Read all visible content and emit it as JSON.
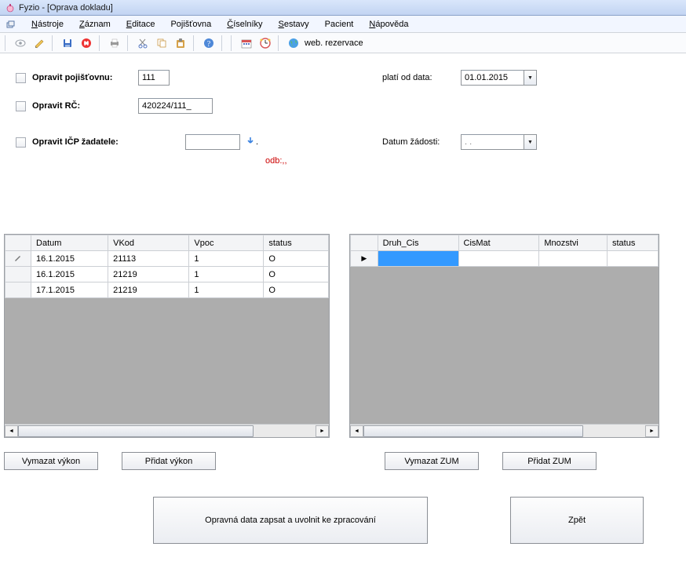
{
  "title": "Fyzio  - [Oprava dokladu]",
  "menubar": {
    "items": [
      "Nástroje",
      "Záznam",
      "Editace",
      "Pojišťovna",
      "Číselníky",
      "Sestavy",
      "Pacient",
      "Nápověda"
    ],
    "accel_pos": [
      0,
      0,
      0,
      null,
      0,
      0,
      null,
      0
    ]
  },
  "toolbar": {
    "web_reservation": "web. rezervace"
  },
  "form": {
    "cb_pojistovna_label": "Opravit pojišťovnu:",
    "pojistovna_value": "111",
    "plati_od_label": "platí od data:",
    "plati_od_value": "01.01.2015",
    "cb_rc_label": "Opravit RČ:",
    "rc_value": "420224/111_",
    "cb_icp_label": "Opravit IČP žadatele:",
    "icp_value": "",
    "icp_dot": ".",
    "odb_label": "odb:,,",
    "datum_zadosti_label": "Datum žádosti:",
    "datum_zadosti_value": ". ."
  },
  "grid_left": {
    "headers": [
      "Datum",
      "VKod",
      "Vpoc",
      "status"
    ],
    "rows": [
      {
        "datum": "16.1.2015",
        "vkod": "21113",
        "vpoc": "1",
        "status": "O",
        "editing": true
      },
      {
        "datum": "16.1.2015",
        "vkod": "21219",
        "vpoc": "1",
        "status": "O",
        "editing": false
      },
      {
        "datum": "17.1.2015",
        "vkod": "21219",
        "vpoc": "1",
        "status": "O",
        "editing": false
      }
    ]
  },
  "grid_right": {
    "headers": [
      "Druh_Cis",
      "CisMat",
      "Mnozstvi",
      "status"
    ]
  },
  "buttons": {
    "vymazat_vykon": "Vymazat výkon",
    "pridat_vykon": "Přidat výkon",
    "vymazat_zum": "Vymazat ZUM",
    "pridat_zum": "Přidat ZUM",
    "zapsat": "Opravná data zapsat a uvolnit ke zpracování",
    "zpet": "Zpět"
  }
}
